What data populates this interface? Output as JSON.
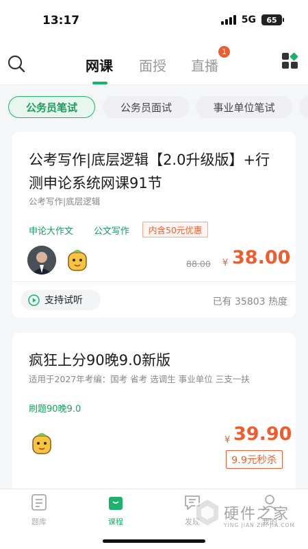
{
  "status_bar": {
    "time": "13:17",
    "network": "5G",
    "battery": "65"
  },
  "top_nav": {
    "tabs": [
      {
        "label": "网课",
        "active": true
      },
      {
        "label": "面授",
        "active": false
      },
      {
        "label": "直播",
        "active": false,
        "badge": "1"
      }
    ]
  },
  "chips": [
    "公务员笔试",
    "公务员面试",
    "事业单位笔试"
  ],
  "courses": [
    {
      "title": "公考写作|底层逻辑【2.0升级版】+行测申论系统网课91节",
      "subtitle": "公考写作|底层逻辑",
      "tags": [
        "申论大作文",
        "公文写作"
      ],
      "promo": "内含50元优惠",
      "old_price": "88.00",
      "currency": "¥",
      "price": "38.00",
      "trial_label": "支持试听",
      "heat": "已有 35803 热度"
    },
    {
      "title": "疯狂上分90晚9.0新版",
      "subtitle": "适用于2027年考编：国考 省考 选调生 事业单位 三支一扶",
      "tags": [
        "刷题90晚9.0"
      ],
      "currency": "¥",
      "price": "39.90",
      "flash_sale": "9.9元秒杀"
    }
  ],
  "bottom_nav": [
    {
      "label": "题库",
      "icon": "question-bank-icon",
      "active": false
    },
    {
      "label": "课程",
      "icon": "course-bag-icon",
      "active": true
    },
    {
      "label": "发现",
      "icon": "discover-icon",
      "active": false
    },
    {
      "label": "我的",
      "icon": "profile-icon",
      "active": false
    }
  ],
  "watermark": {
    "brand": "硬件之家",
    "pinyin": "YING JIAN ZHI JIA.COM"
  },
  "colors": {
    "accent": "#1bb36b",
    "price": "#ef5d2f"
  }
}
